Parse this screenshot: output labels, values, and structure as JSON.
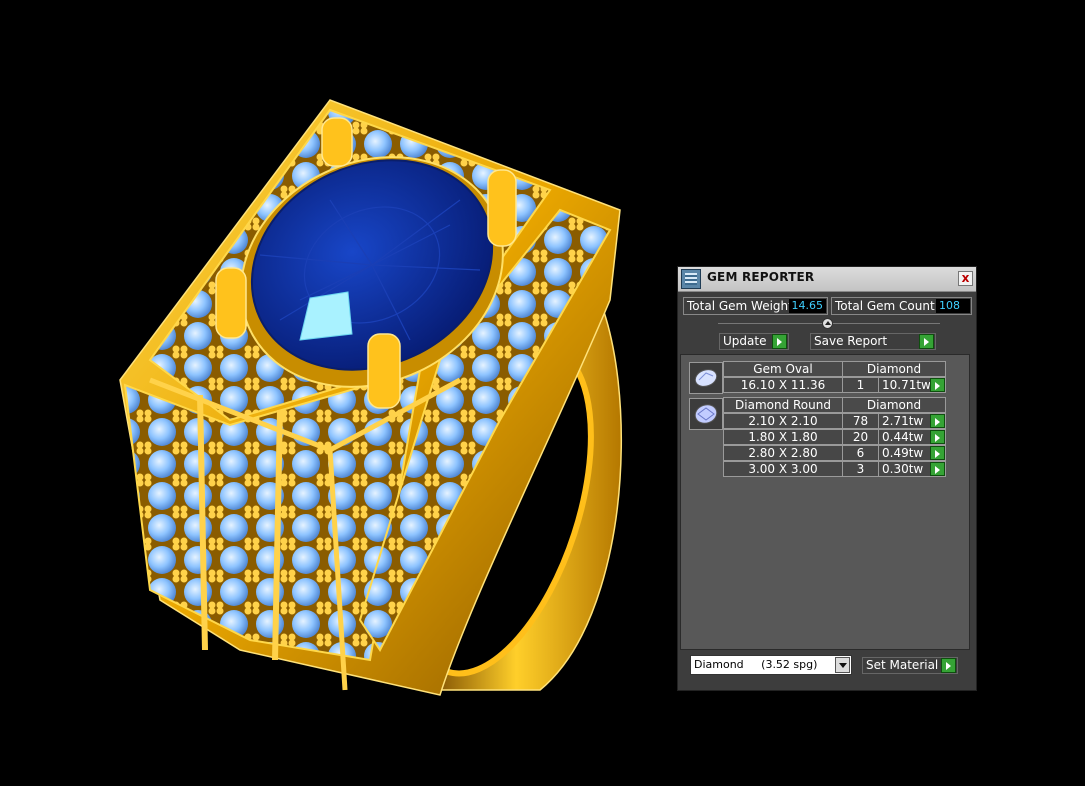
{
  "panel": {
    "title": "GEM REPORTER",
    "close_label": "x",
    "total_weight_label": "Total Gem Weight",
    "total_weight_value": "14.65",
    "total_count_label": "Total Gem Count",
    "total_count_value": "108",
    "update_label": "Update",
    "save_report_label": "Save Report",
    "groups": [
      {
        "gem_type": "Gem Oval",
        "material": "Diamond",
        "rows": [
          {
            "size": "16.10 X 11.36",
            "count": "1",
            "weight": "10.71tw"
          }
        ]
      },
      {
        "gem_type": "Diamond Round",
        "material": "Diamond",
        "rows": [
          {
            "size": "2.10 X 2.10",
            "count": "78",
            "weight": "2.71tw"
          },
          {
            "size": "1.80 X 1.80",
            "count": "20",
            "weight": "0.44tw"
          },
          {
            "size": "2.80 X 2.80",
            "count": "6",
            "weight": "0.49tw"
          },
          {
            "size": "3.00 X 3.00",
            "count": "3",
            "weight": "0.30tw"
          }
        ]
      }
    ],
    "material_select_value": "Diamond     (3.52 spg)",
    "set_material_label": "Set Material"
  },
  "colors": {
    "gold": "#f2b400",
    "sapphire": "#0a2fa0",
    "diamond": "#8ec4ff",
    "panel_bg": "#3d3d3d",
    "value_text": "#3fd0ff",
    "go_button": "#35a335"
  },
  "icons": {
    "title": "gem-reporter-icon",
    "close": "close-icon",
    "collapse": "collapse-up-icon",
    "go": "play-arrow-icon",
    "oval_gem": "oval-gem-icon",
    "round_gem": "round-gem-icon",
    "dropdown": "chevron-down-icon"
  }
}
